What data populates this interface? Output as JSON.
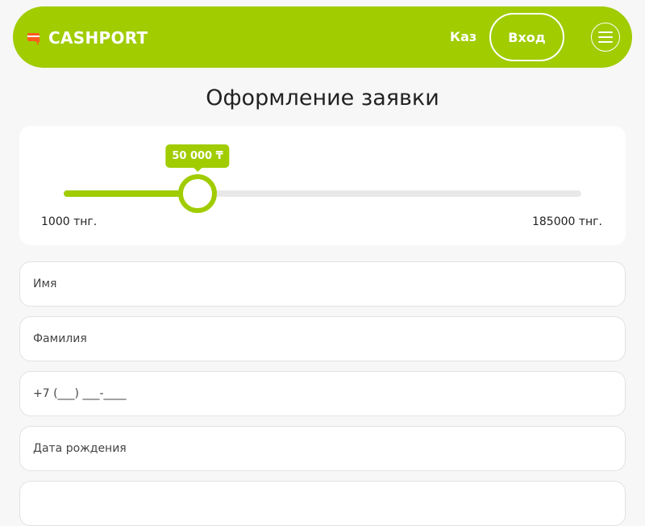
{
  "header": {
    "brand": "CASHPORT",
    "lang_label": "Каз",
    "login_label": "Вход",
    "menu_icon": "hamburger-menu-icon"
  },
  "colors": {
    "accent": "#a0cc00",
    "logo_icon": "#ff5a1f",
    "background": "#f7f7f7",
    "card": "#ffffff"
  },
  "page": {
    "title": "Оформление заявки"
  },
  "slider": {
    "value_label": "50 000 ₸",
    "min_label": "1000 тнг.",
    "max_label": "185000 тнг.",
    "min": 1000,
    "max": 185000,
    "value": 50000
  },
  "form": {
    "fields": [
      {
        "placeholder": "Имя"
      },
      {
        "placeholder": "Фамилия"
      },
      {
        "placeholder": "+7 (___) ___-____"
      },
      {
        "placeholder": "Дата рождения"
      }
    ]
  }
}
